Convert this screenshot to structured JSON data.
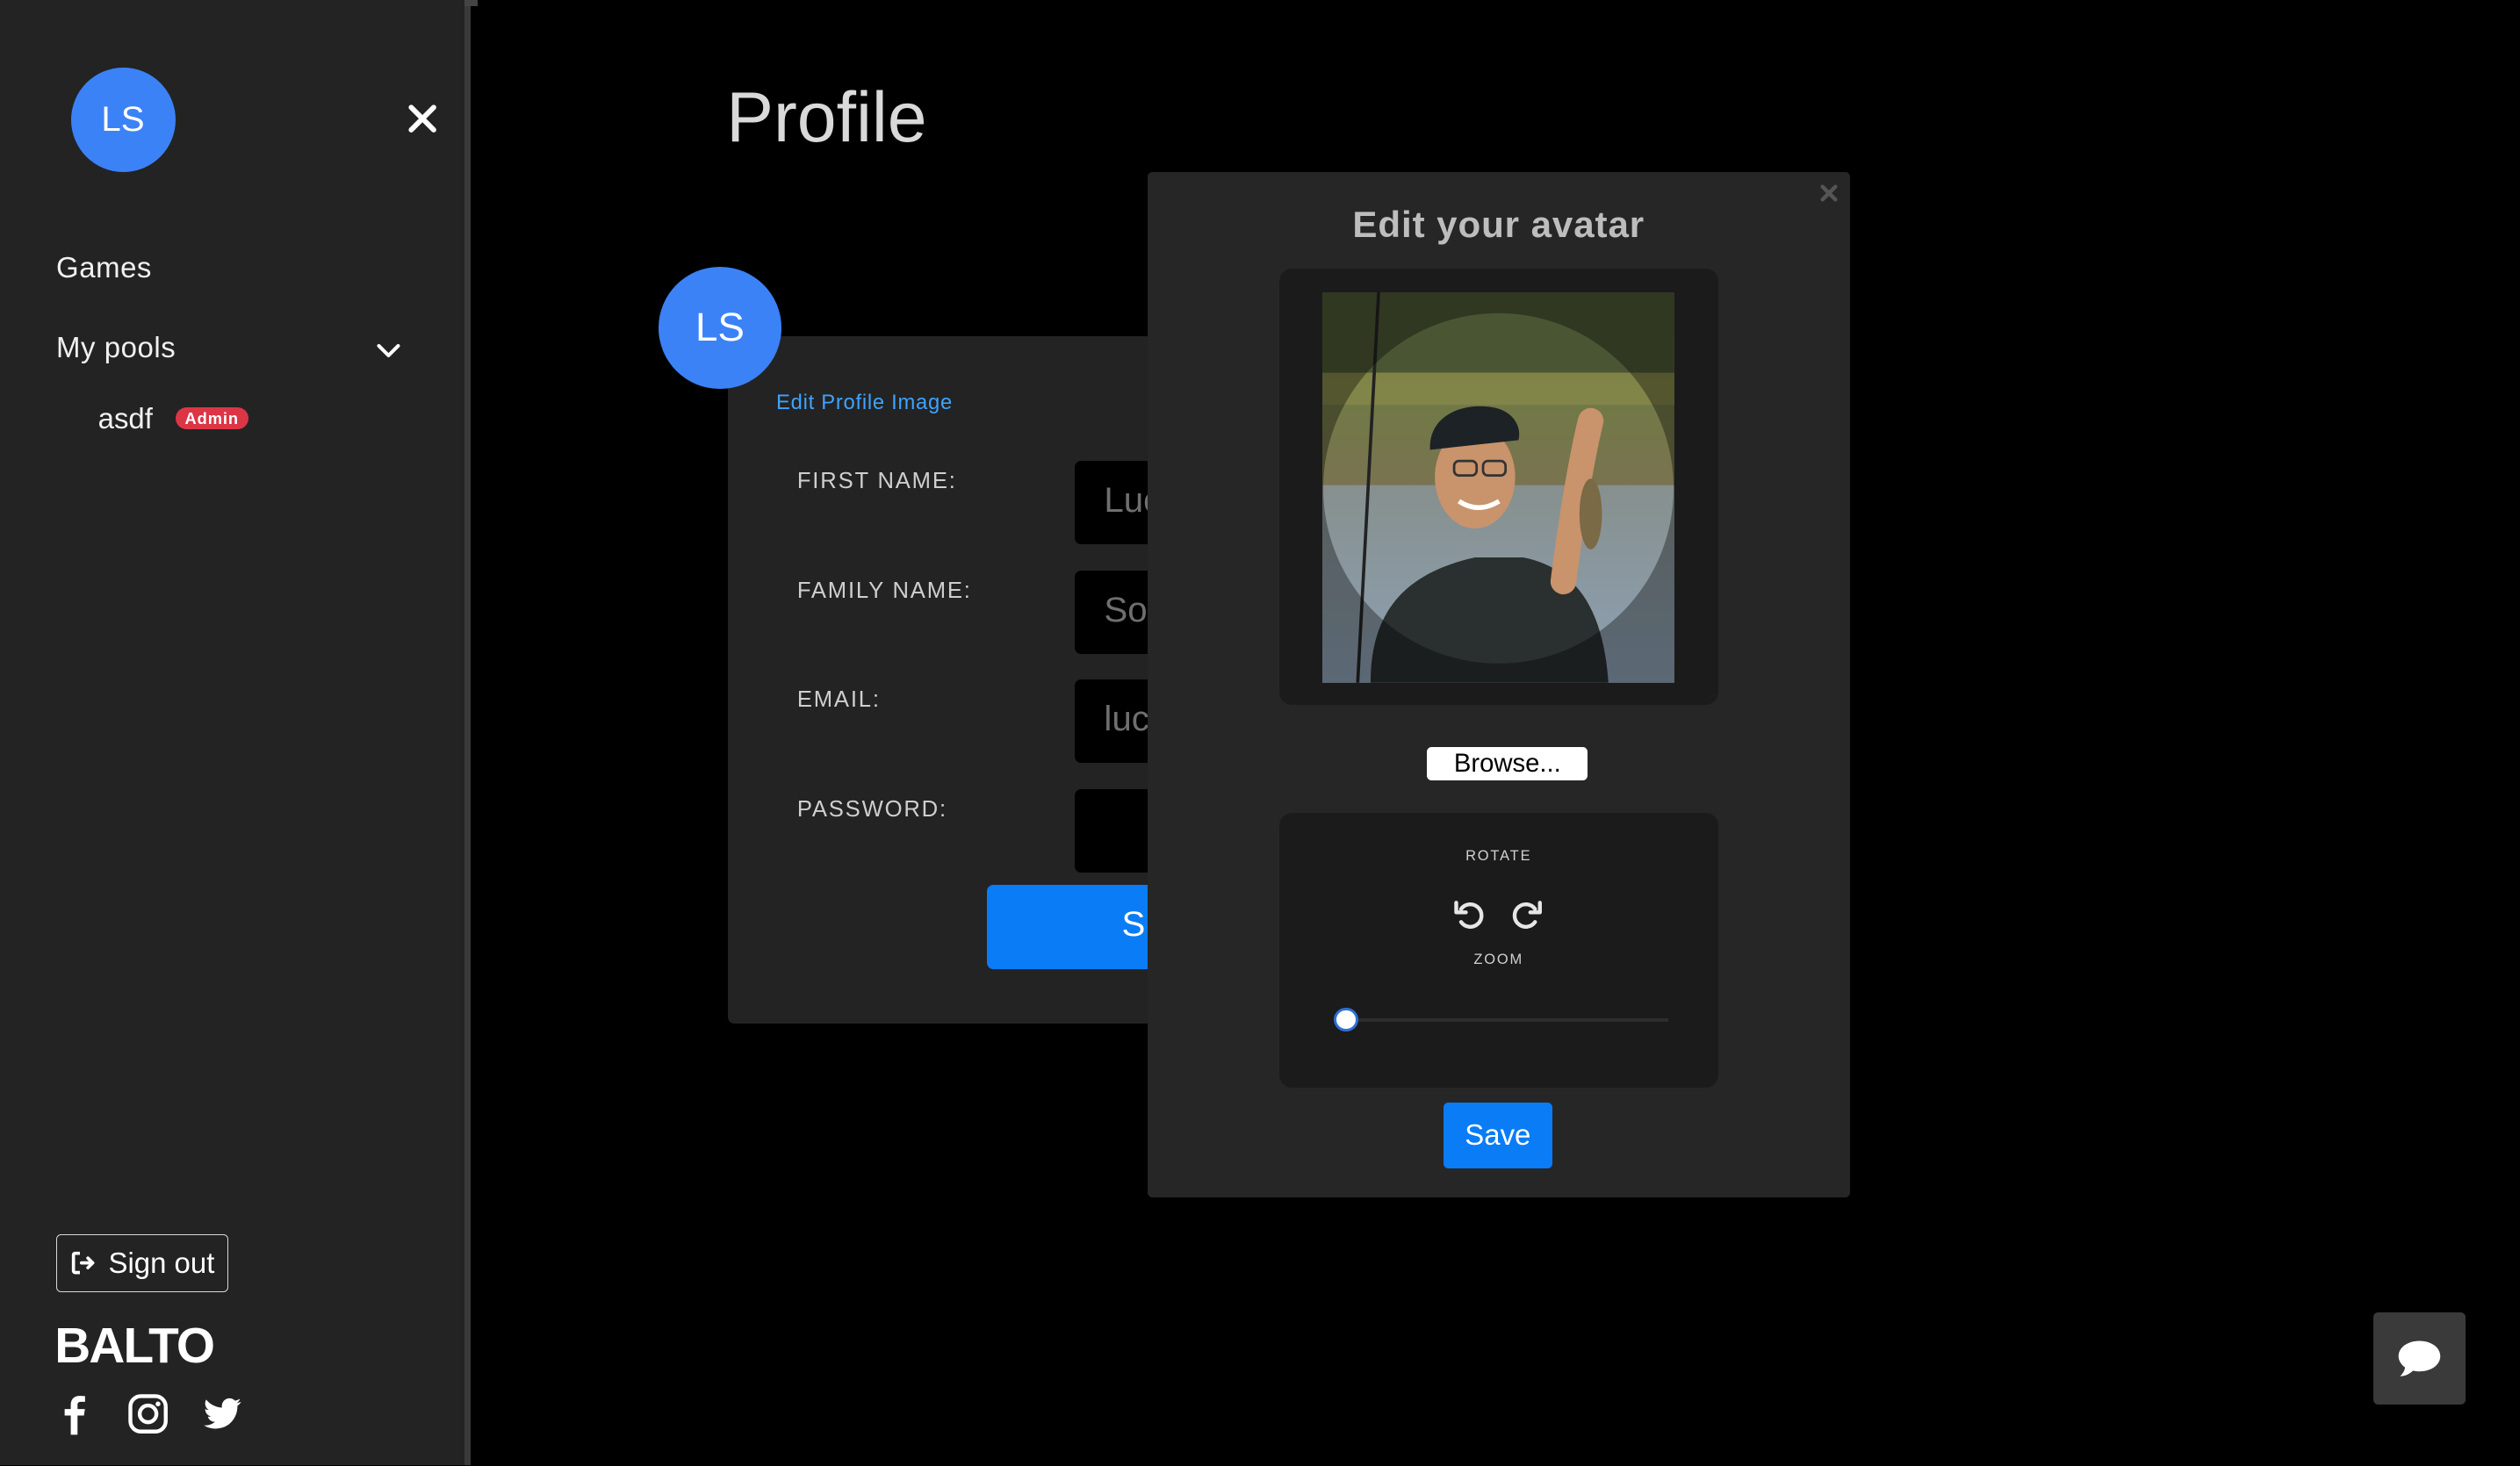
{
  "sidebar": {
    "avatar_initials": "LS",
    "nav": {
      "games": "Games",
      "my_pools": "My pools",
      "pools": [
        {
          "name": "asdf",
          "badge": "Admin"
        }
      ]
    },
    "sign_out": "Sign out",
    "brand": "BALTO",
    "social_icons": [
      "facebook-icon",
      "instagram-icon",
      "twitter-icon"
    ]
  },
  "profile": {
    "title": "Profile",
    "avatar_initials": "LS",
    "edit_image_link": "Edit Profile Image",
    "fields": [
      {
        "label": "FIRST NAME:",
        "value": "Luc"
      },
      {
        "label": "FAMILY NAME:",
        "value": "So"
      },
      {
        "label": "EMAIL:",
        "value": "luc"
      },
      {
        "label": "PASSWORD:",
        "value": ""
      }
    ],
    "submit_visible": "S"
  },
  "modal": {
    "title": "Edit your avatar",
    "browse": "Browse...",
    "rotate_label": "ROTATE",
    "zoom_label": "ZOOM",
    "zoom_level": 0,
    "save": "Save"
  },
  "colors": {
    "accent": "#0a7cf5",
    "avatar": "#3b82f6",
    "badge": "#dc3545"
  }
}
